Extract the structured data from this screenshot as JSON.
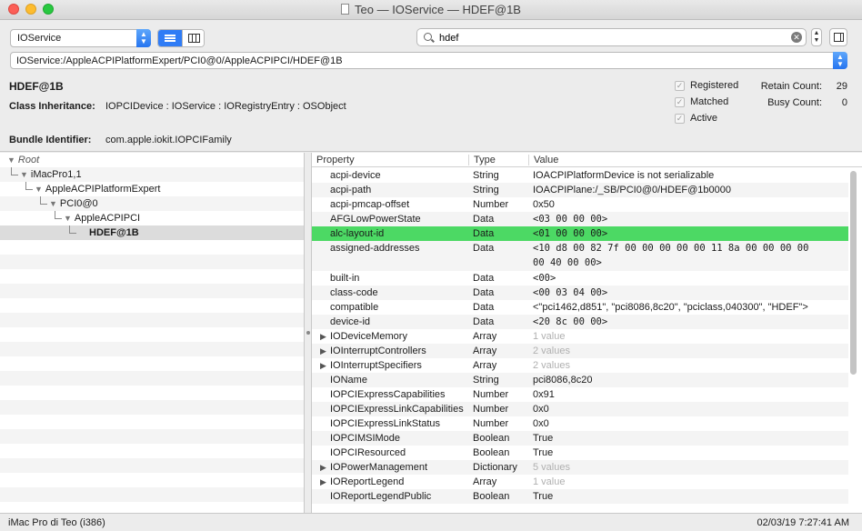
{
  "window": {
    "title": "Teo — IOService — HDEF@1B"
  },
  "toolbar": {
    "plane_select": "IOService",
    "search": {
      "value": "hdef",
      "placeholder": ""
    }
  },
  "path": "IOService:/AppleACPIPlatformExpert/PCI0@0/AppleACPIPCI/HDEF@1B",
  "info": {
    "name": "HDEF@1B",
    "inheritance_label": "Class Inheritance:",
    "inheritance_value": "IOPCIDevice : IOService : IORegistryEntry : OSObject",
    "bundle_label": "Bundle Identifier:",
    "bundle_value": "com.apple.iokit.IOPCIFamily",
    "flags": [
      {
        "label": "Registered",
        "checked": true
      },
      {
        "label": "Matched",
        "checked": true
      },
      {
        "label": "Active",
        "checked": true
      }
    ],
    "retain_label": "Retain Count:",
    "retain_value": "29",
    "busy_label": "Busy Count:",
    "busy_value": "0"
  },
  "tree": [
    {
      "label": "Root",
      "depth": 0,
      "italic": true,
      "expanded": true
    },
    {
      "label": "iMacPro1,1",
      "depth": 1,
      "expanded": true
    },
    {
      "label": "AppleACPIPlatformExpert",
      "depth": 2,
      "expanded": true
    },
    {
      "label": "PCI0@0",
      "depth": 3,
      "expanded": true
    },
    {
      "label": "AppleACPIPCI",
      "depth": 4,
      "expanded": true
    },
    {
      "label": "HDEF@1B",
      "depth": 5,
      "selected": true
    }
  ],
  "table": {
    "headers": {
      "property": "Property",
      "type": "Type",
      "value": "Value"
    },
    "rows": [
      {
        "key": "acpi-device",
        "type": "String",
        "value": "IOACPIPlatformDevice is not serializable"
      },
      {
        "key": "acpi-path",
        "type": "String",
        "value": "IOACPIPlane:/_SB/PCI0@0/HDEF@1b0000"
      },
      {
        "key": "acpi-pmcap-offset",
        "type": "Number",
        "value": "0x50"
      },
      {
        "key": "AFGLowPowerState",
        "type": "Data",
        "value": "<03 00 00 00>",
        "mono": true
      },
      {
        "key": "alc-layout-id",
        "type": "Data",
        "value": "<01 00 00 00>",
        "mono": true,
        "highlight": true
      },
      {
        "key": "assigned-addresses",
        "type": "Data",
        "value": "<10 d8 00 82 7f 00 00 00 00 00 11 8a 00 00 00 00",
        "value2": "00 40 00 00>",
        "mono": true,
        "tall": true
      },
      {
        "key": "built-in",
        "type": "Data",
        "value": "<00>",
        "mono": true
      },
      {
        "key": "class-code",
        "type": "Data",
        "value": "<00 03 04 00>",
        "mono": true
      },
      {
        "key": "compatible",
        "type": "Data",
        "value": "<\"pci1462,d851\", \"pci8086,8c20\", \"pciclass,040300\", \"HDEF\">"
      },
      {
        "key": "device-id",
        "type": "Data",
        "value": "<20 8c 00 00>",
        "mono": true
      },
      {
        "key": "IODeviceMemory",
        "type": "Array",
        "value": "1 value",
        "disclosure": true,
        "grey": true
      },
      {
        "key": "IOInterruptControllers",
        "type": "Array",
        "value": "2 values",
        "disclosure": true,
        "grey": true
      },
      {
        "key": "IOInterruptSpecifiers",
        "type": "Array",
        "value": "2 values",
        "disclosure": true,
        "grey": true
      },
      {
        "key": "IOName",
        "type": "String",
        "value": "pci8086,8c20"
      },
      {
        "key": "IOPCIExpressCapabilities",
        "type": "Number",
        "value": "0x91"
      },
      {
        "key": "IOPCIExpressLinkCapabilities",
        "type": "Number",
        "value": "0x0"
      },
      {
        "key": "IOPCIExpressLinkStatus",
        "type": "Number",
        "value": "0x0"
      },
      {
        "key": "IOPCIMSIMode",
        "type": "Boolean",
        "value": "True"
      },
      {
        "key": "IOPCIResourced",
        "type": "Boolean",
        "value": "True"
      },
      {
        "key": "IOPowerManagement",
        "type": "Dictionary",
        "value": "5 values",
        "disclosure": true,
        "grey": true
      },
      {
        "key": "IOReportLegend",
        "type": "Array",
        "value": "1 value",
        "disclosure": true,
        "grey": true
      },
      {
        "key": "IOReportLegendPublic",
        "type": "Boolean",
        "value": "True"
      }
    ]
  },
  "status": {
    "left": "iMac Pro di Teo (i386)",
    "right": "02/03/19 7:27:41 AM"
  }
}
